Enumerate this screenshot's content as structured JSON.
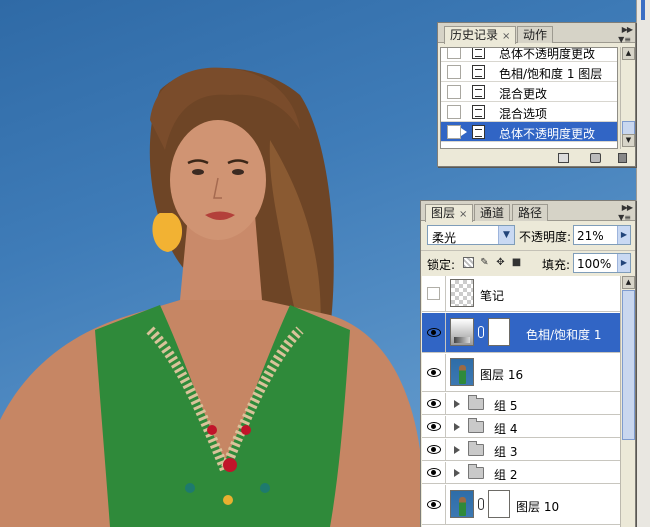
{
  "history_panel": {
    "tabs": [
      {
        "label": "历史记录",
        "active": true,
        "close": "×"
      },
      {
        "label": "动作",
        "active": false
      }
    ],
    "items": [
      {
        "label": "总体不透明度更改",
        "selected": false
      },
      {
        "label": "色相/饱和度 1 图层",
        "selected": false
      },
      {
        "label": "混合更改",
        "selected": false
      },
      {
        "label": "混合选项",
        "selected": false
      },
      {
        "label": "总体不透明度更改",
        "selected": true
      }
    ],
    "footer_icons": [
      "new-document-icon",
      "snapshot-camera-icon",
      "trash-icon"
    ]
  },
  "layers_panel": {
    "tabs": [
      {
        "label": "图层",
        "active": true,
        "close": "×"
      },
      {
        "label": "通道",
        "active": false
      },
      {
        "label": "路径",
        "active": false
      }
    ],
    "blend_mode": "柔光",
    "opacity_label": "不透明度:",
    "opacity_value": "21%",
    "lock_label": "锁定:",
    "fill_label": "填充:",
    "fill_value": "100%",
    "layers": [
      {
        "name": "笔记",
        "visible": false,
        "kind": "transparent",
        "selected": false
      },
      {
        "name": "色相/饱和度 1",
        "visible": true,
        "kind": "adjustment-with-mask",
        "selected": true
      },
      {
        "name": "图层 16",
        "visible": true,
        "kind": "photo",
        "selected": false
      },
      {
        "name": "组 5",
        "visible": true,
        "kind": "group",
        "selected": false
      },
      {
        "name": "组 4",
        "visible": true,
        "kind": "group",
        "selected": false
      },
      {
        "name": "组 3",
        "visible": true,
        "kind": "group",
        "selected": false
      },
      {
        "name": "组 2",
        "visible": true,
        "kind": "group",
        "selected": false
      },
      {
        "name": "图层 10",
        "visible": true,
        "kind": "photo-with-mask",
        "selected": false
      }
    ]
  },
  "colors": {
    "selection": "#3165c5",
    "panel_bg": "#ece9d8",
    "canvas_bg": "#3f7cb8",
    "dress": "#2f8a3a",
    "earring": "#f2b233"
  }
}
